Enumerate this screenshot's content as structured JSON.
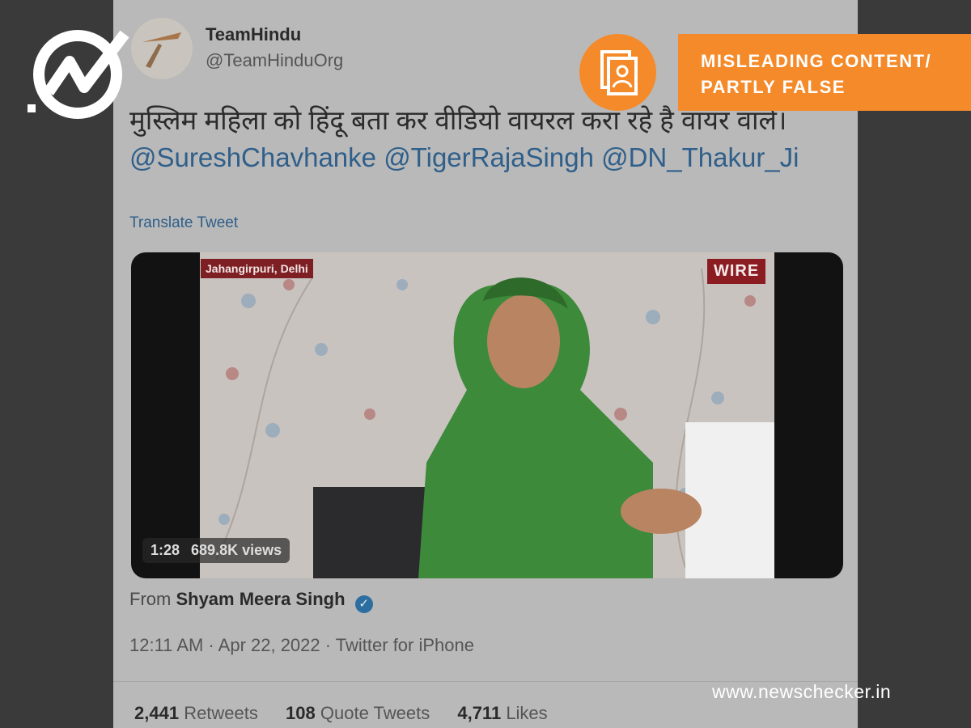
{
  "tweet": {
    "display_name": "TeamHindu",
    "handle": "@TeamHinduOrg",
    "text_main": "मुस्लिम महिला को हिंदू बता कर वीडियो वायरल करा रहे है वायर वाले।",
    "mentions": [
      "@SureshChavhanke",
      "@TigerRajaSingh",
      "@DN_Thakur_Ji"
    ],
    "translate_label": "Translate Tweet",
    "video": {
      "location_tag": "Jahangirpuri, Delhi",
      "source_tag": "WIRE",
      "duration": "1:28",
      "views": "689.8K views"
    },
    "from_prefix": "From",
    "from_name": "Shyam Meera Singh",
    "meta": "12:11 AM · Apr 22, 2022 · Twitter for iPhone",
    "stats": {
      "retweets_count": "2,441",
      "retweets_label": "Retweets",
      "quotes_count": "108",
      "quotes_label": "Quote Tweets",
      "likes_count": "4,711",
      "likes_label": "Likes"
    }
  },
  "overlay": {
    "rating_line1": "MISLEADING CONTENT/",
    "rating_line2": "PARTLY FALSE",
    "site_url": "www.newschecker.in",
    "rating_color": "#f58a2a"
  }
}
